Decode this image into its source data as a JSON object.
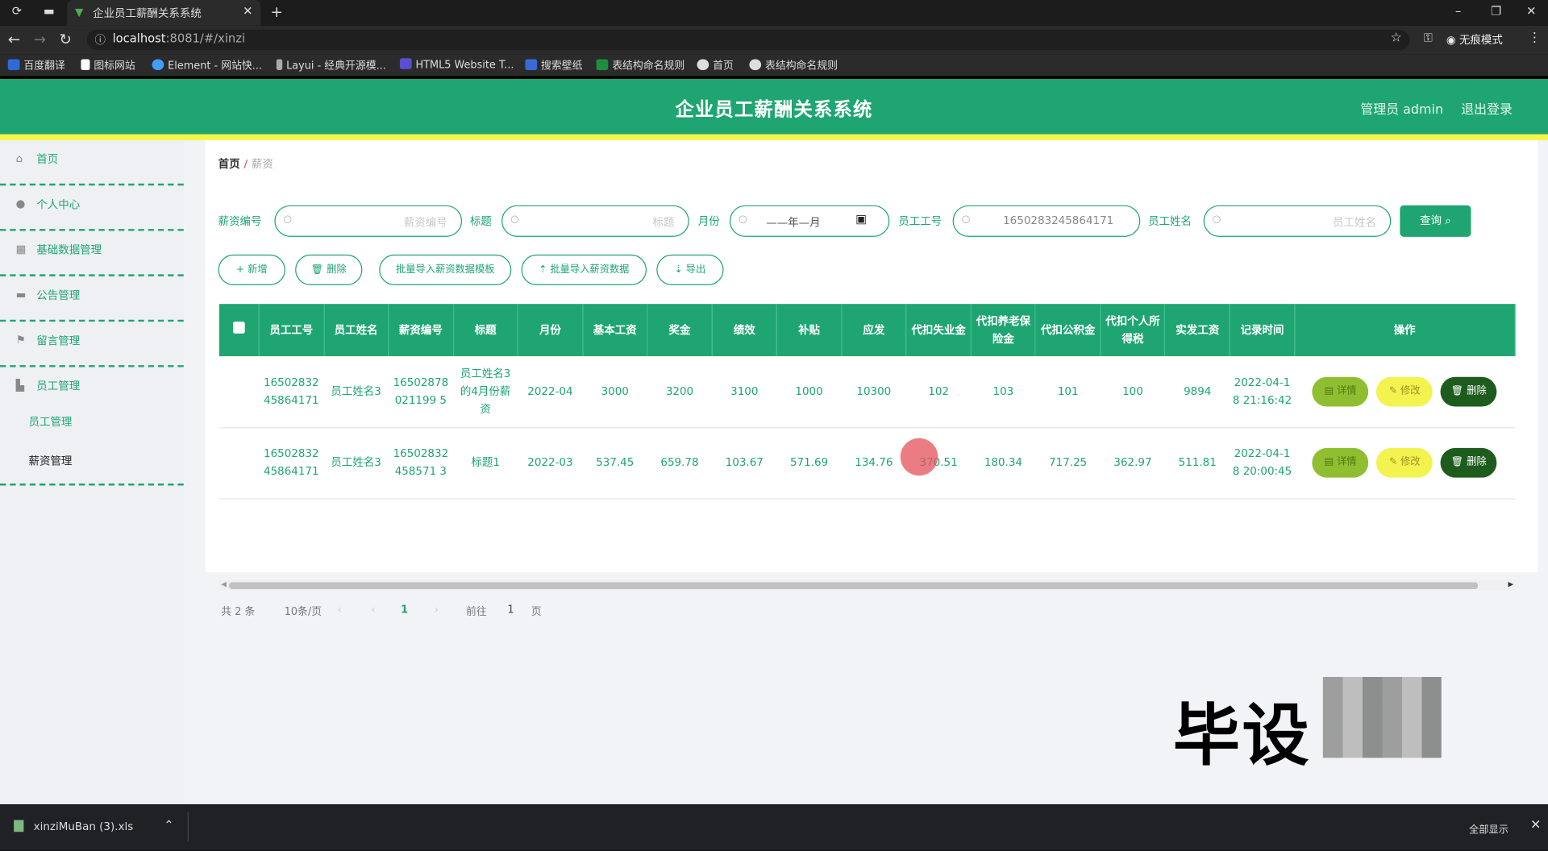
{
  "browser": {
    "tab_title": "企业员工薪酬关系系统",
    "url_host": "localhost",
    "url_rest": ":8081/#/xinzi",
    "incognito": "无痕模式",
    "bookmarks": [
      "百度翻译",
      "图标网站",
      "Element - 网站快...",
      "Layui - 经典开源模...",
      "HTML5 Website T...",
      "搜索壁纸",
      "表结构命名规则",
      "首页",
      "表结构命名规则"
    ]
  },
  "header": {
    "title": "企业员工薪酬关系系统",
    "admin": "管理员 admin",
    "logout": "退出登录"
  },
  "sidebar": {
    "items": [
      {
        "label": "首页",
        "icon": "home-icon"
      },
      {
        "label": "个人中心",
        "icon": "user-icon"
      },
      {
        "label": "基础数据管理",
        "icon": "grid-icon"
      },
      {
        "label": "公告管理",
        "icon": "notice-icon"
      },
      {
        "label": "留言管理",
        "icon": "flag-icon"
      },
      {
        "label": "员工管理",
        "icon": "staff-icon"
      }
    ],
    "sub": [
      "员工管理",
      "薪资管理"
    ]
  },
  "breadcrumb": {
    "home": "首页",
    "sep": "/",
    "current": "薪资"
  },
  "filters": {
    "salary_no_label": "薪资编号",
    "salary_no_ph": "薪资编号",
    "title_label": "标题",
    "title_ph": "标题",
    "month_label": "月份",
    "month_ph": "——年—月",
    "emp_no_label": "员工工号",
    "emp_no_value": "1650283245864171",
    "emp_name_label": "员工姓名",
    "emp_name_ph": "员工姓名",
    "search": "查询"
  },
  "actions": {
    "add": "+ 新增",
    "delete": "删除",
    "import_tpl": "批量导入薪资数据模板",
    "import": "批量导入薪资数据",
    "export": "导出"
  },
  "table": {
    "headers": [
      "员工工号",
      "员工姓名",
      "薪资编号",
      "标题",
      "月份",
      "基本工资",
      "奖金",
      "绩效",
      "补贴",
      "应发",
      "代扣失业金",
      "代扣养老保险金",
      "代扣公积金",
      "代扣个人所得税",
      "实发工资",
      "记录时间",
      "操作"
    ],
    "rows": [
      [
        "1650283245864171",
        "员工姓名3",
        "16502878021199 5",
        "员工姓名3的4月份薪资",
        "2022-04",
        "3000",
        "3200",
        "3100",
        "1000",
        "10300",
        "102",
        "103",
        "101",
        "100",
        "9894",
        "2022-04-18 21:16:42"
      ],
      [
        "1650283245864171",
        "员工姓名3",
        "16502832458571 3",
        "标题1",
        "2022-03",
        "537.45",
        "659.78",
        "103.67",
        "571.69",
        "134.76",
        "370.51",
        "180.34",
        "717.25",
        "362.97",
        "511.81",
        "2022-04-18 20:00:45"
      ]
    ],
    "op_detail": "详情",
    "op_edit": "修改",
    "op_delete": "删除"
  },
  "pager": {
    "total": "共 2 条",
    "size": "10条/页",
    "page": "1",
    "goto": "前往",
    "goto_val": "1",
    "unit": "页"
  },
  "watermark": "毕设",
  "download": {
    "file": "xinziMuBan (3).xls",
    "show_all": "全部显示"
  },
  "colors": {
    "primary": "#1fa572",
    "accent_bar": "#f5f545"
  }
}
